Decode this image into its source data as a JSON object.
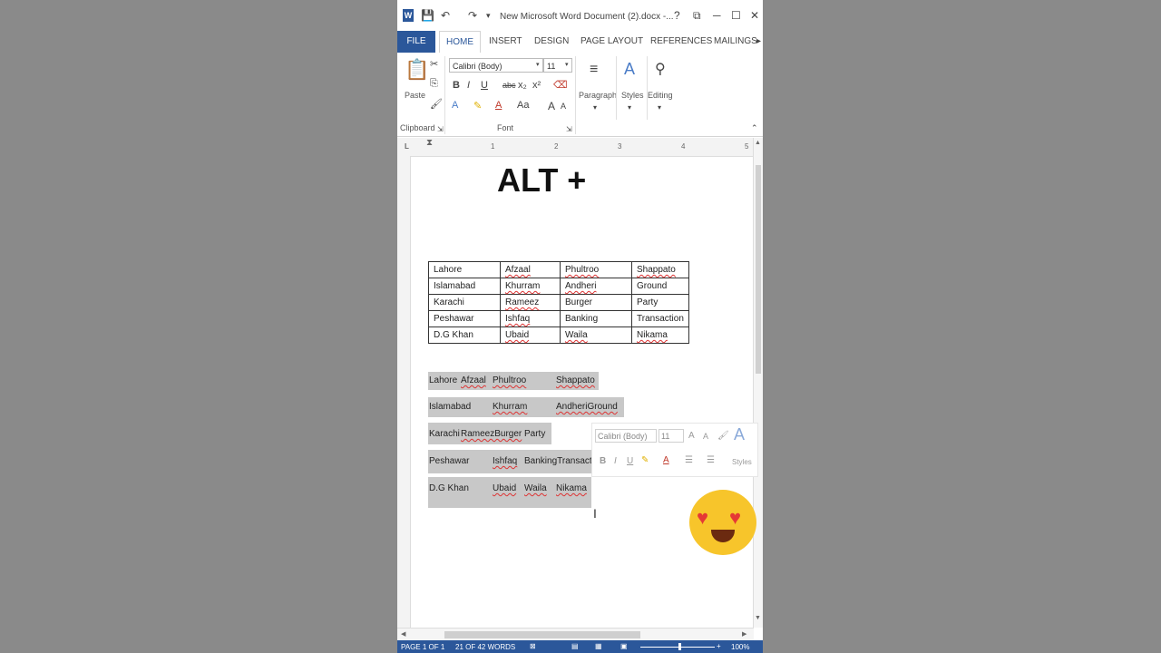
{
  "window": {
    "title": "New Microsoft Word Document (2).docx -...",
    "help": "?",
    "minimize": "─",
    "restore": "☐",
    "close": "✕"
  },
  "tabs": [
    "FILE",
    "HOME",
    "INSERT",
    "DESIGN",
    "PAGE LAYOUT",
    "REFERENCES",
    "MAILINGS"
  ],
  "ribbon": {
    "paste_label": "Paste",
    "clipboard_label": "Clipboard",
    "font_name": "Calibri (Body)",
    "font_size": "11",
    "font_group_label": "Font",
    "bold": "B",
    "italic": "I",
    "underline": "U",
    "strike": "abc",
    "subscript": "x₂",
    "superscript": "x²",
    "change_case": "Aa",
    "grow_font": "A",
    "shrink_font": "A",
    "paragraph_label": "Paragraph",
    "styles_label": "Styles",
    "editing_label": "Editing"
  },
  "ruler": {
    "numbers": [
      "1",
      "2",
      "3",
      "4",
      "5"
    ]
  },
  "overlay_text": "ALT +",
  "table": {
    "rows": [
      [
        "Lahore",
        "Afzaal",
        "Phultroo",
        "Shappato"
      ],
      [
        "Islamabad",
        "Khurram",
        "Andheri",
        "Ground"
      ],
      [
        "Karachi",
        "Rameez",
        "Burger",
        "Party"
      ],
      [
        "Peshawar",
        "Ishfaq",
        "Banking",
        "Transaction"
      ],
      [
        "D.G Khan",
        "Ubaid",
        "Waila",
        "Nikama"
      ]
    ]
  },
  "tabbed_text": {
    "line1": [
      "Lahore",
      "Afzaal",
      "Phultroo",
      "Shappato"
    ],
    "line2": [
      "Islamabad",
      "Khurram",
      "AndheriGround"
    ],
    "line3": [
      "Karachi",
      "RameezBurger",
      "Party"
    ],
    "line4": [
      "Peshawar",
      "Ishfaq",
      "BankingTransacti"
    ],
    "line5": [
      "D.G Khan",
      "Ubaid",
      "Waila",
      "Nikama"
    ]
  },
  "mini_toolbar": {
    "font_name": "Calibri (Body)",
    "font_size": "11",
    "bold": "B",
    "italic": "I",
    "underline": "U",
    "styles_label": "Styles"
  },
  "status": {
    "page": "PAGE 1 OF 1",
    "words": "21 OF 42 WORDS",
    "zoom": "100%"
  },
  "colors": {
    "accent": "#2b579a",
    "selection": "#c8c8c8"
  }
}
